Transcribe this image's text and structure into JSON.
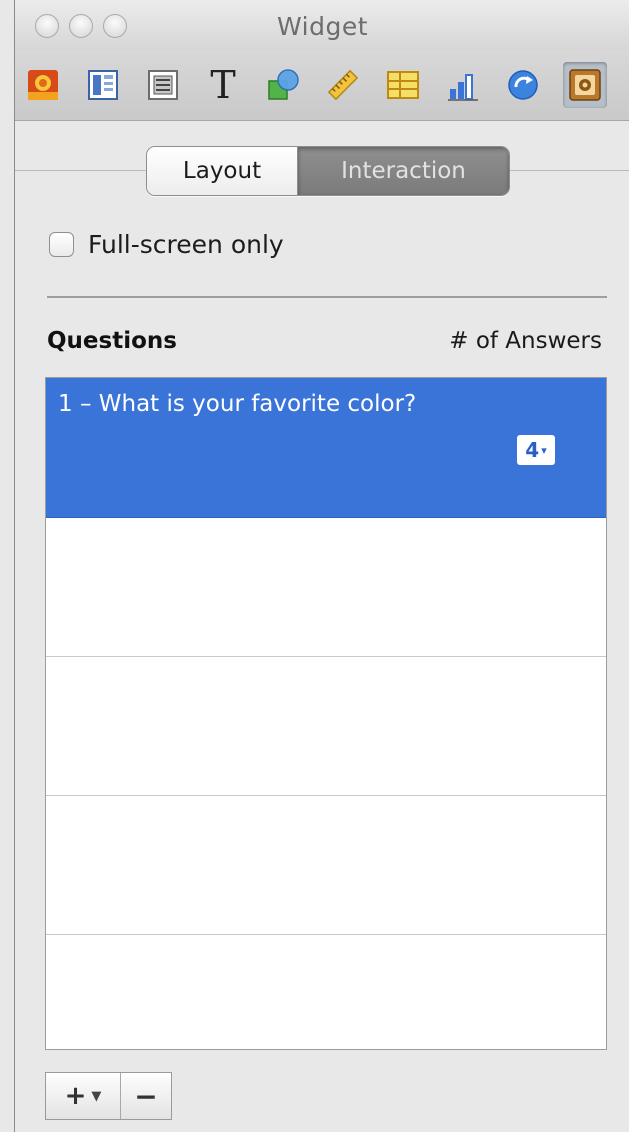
{
  "window": {
    "title": "Widget"
  },
  "toolbar": {
    "buttons": [
      {
        "icon": "document-icon"
      },
      {
        "icon": "layout-icon"
      },
      {
        "icon": "wrap-icon"
      },
      {
        "icon": "text-icon",
        "glyph": "T"
      },
      {
        "icon": "shapes-icon"
      },
      {
        "icon": "metrics-icon"
      },
      {
        "icon": "table-icon"
      },
      {
        "icon": "chart-icon"
      },
      {
        "icon": "link-icon"
      },
      {
        "icon": "widget-icon",
        "selected": true
      }
    ]
  },
  "tabs": {
    "layout": "Layout",
    "interaction": "Interaction",
    "active": "interaction"
  },
  "options": {
    "fullscreen_label": "Full-screen only",
    "fullscreen_checked": false
  },
  "questions": {
    "header_questions": "Questions",
    "header_answers": "# of Answers",
    "rows": [
      {
        "text": "1 – What is your favorite color?",
        "answers": "4",
        "selected": true
      },
      {
        "text": "",
        "answers": ""
      },
      {
        "text": "",
        "answers": ""
      },
      {
        "text": "",
        "answers": ""
      },
      {
        "text": "",
        "answers": ""
      }
    ]
  },
  "controls": {
    "add_label": "+",
    "remove_label": "−"
  },
  "colors": {
    "selection": "#3a74d8",
    "toolbar_bg": "#d0d0d0",
    "window_bg": "#e8e8e8"
  }
}
